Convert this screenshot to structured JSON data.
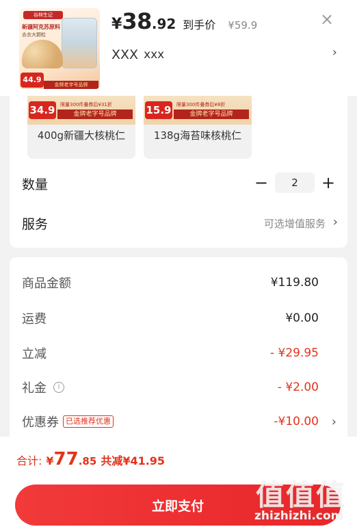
{
  "header": {
    "thumb": {
      "brand": "谷林生记",
      "headline": "新疆阿克苏原料",
      "subline": "去衣大颗粒",
      "price": "44.9",
      "tag": "金牌老字号品牌"
    },
    "currency": "¥",
    "price_int": "38",
    "price_dec": ".92",
    "price_label": "到手价",
    "original_price": "¥59.9",
    "close": "×",
    "spec_primary": "XXX",
    "spec_secondary": "xxx",
    "spec_arrow": "›"
  },
  "variants": [
    {
      "price": "34.9",
      "promo": "限量300件叠券后¥31折",
      "tag": "金牌老字号品牌",
      "name": "400g新疆大核桃仁"
    },
    {
      "price": "15.9",
      "promo": "限量300件叠券后¥8折",
      "tag": "金牌老字号品牌",
      "name": "138g海苔味核桃仁"
    }
  ],
  "quantity": {
    "label": "数量",
    "minus": "−",
    "value": "2",
    "plus": "+"
  },
  "service": {
    "label": "服务",
    "value": "可选增值服务",
    "arrow": "›"
  },
  "summary": {
    "goods_label": "商品金额",
    "goods_value": "¥119.80",
    "shipping_label": "运费",
    "shipping_value": "¥0.00",
    "discount_label": "立减",
    "discount_value": "- ¥29.95",
    "gift_label": "礼金",
    "gift_info": "i",
    "gift_value": "- ¥2.00",
    "coupon_label": "优惠券",
    "coupon_badge": "已选推荐优惠",
    "coupon_value": "-¥10.00",
    "coupon_arrow": "›"
  },
  "footer": {
    "total_label": "合计:",
    "total_currency": "¥",
    "total_int": "77",
    "total_dec": ".85",
    "saved": "共减¥41.95",
    "pay_label": "立即支付"
  },
  "watermark": {
    "glyphs": "值值值",
    "text": "zhizhizhi.com"
  },
  "colors": {
    "accent": "#e4321b",
    "pay_button": "#ee2f30",
    "background": "#f2f2f2"
  }
}
